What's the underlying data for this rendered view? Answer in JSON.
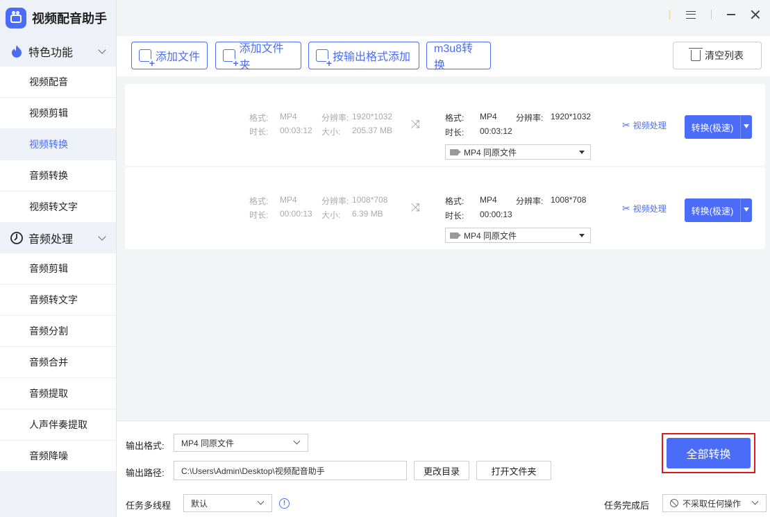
{
  "app": {
    "title": "视频配音助手"
  },
  "sidebar": {
    "groups": [
      {
        "label": "特色功能",
        "items": [
          {
            "label": "视频配音"
          },
          {
            "label": "视频剪辑"
          },
          {
            "label": "视频转换",
            "active": true
          },
          {
            "label": "音频转换"
          },
          {
            "label": "视频转文字"
          }
        ]
      },
      {
        "label": "音频处理",
        "items": [
          {
            "label": "音频剪辑"
          },
          {
            "label": "音频转文字"
          },
          {
            "label": "音频分割"
          },
          {
            "label": "音频合并"
          },
          {
            "label": "音频提取"
          },
          {
            "label": "人声伴奏提取"
          },
          {
            "label": "音频降噪"
          }
        ]
      }
    ]
  },
  "toolbar": {
    "add_file": "添加文件",
    "add_folder": "添加文件夹",
    "add_by_format": "按输出格式添加",
    "m3u8": "m3u8转换",
    "clear_list": "清空列表"
  },
  "labels": {
    "format": "格式:",
    "resolution": "分辨率:",
    "duration": "时长:",
    "size": "大小:",
    "process": "视频处理",
    "convert": "转换(极速)"
  },
  "files": [
    {
      "src": {
        "format": "MP4",
        "resolution": "1920*1032",
        "duration": "00:03:12",
        "size": "205.37 MB"
      },
      "out": {
        "format": "MP4",
        "resolution": "1920*1032",
        "duration": "00:03:12",
        "select": "MP4  同原文件"
      }
    },
    {
      "src": {
        "format": "MP4",
        "resolution": "1008*708",
        "duration": "00:00:13",
        "size": "6.39 MB"
      },
      "out": {
        "format": "MP4",
        "resolution": "1008*708",
        "duration": "00:00:13",
        "select": "MP4  同原文件"
      }
    }
  ],
  "bottom": {
    "output_format_label": "输出格式:",
    "output_format_value": "MP4  同原文件",
    "output_path_label": "输出路径:",
    "output_path_value": "C:\\Users\\Admin\\Desktop\\视频配音助手",
    "change_dir": "更改目录",
    "open_folder": "打开文件夹",
    "threads_label": "任务多线程",
    "threads_value": "默认",
    "after_label": "任务完成后",
    "after_value": "不采取任何操作",
    "convert_all": "全部转换"
  },
  "colors": {
    "accent": "#4a6cf7",
    "highlight": "#e0171d"
  }
}
